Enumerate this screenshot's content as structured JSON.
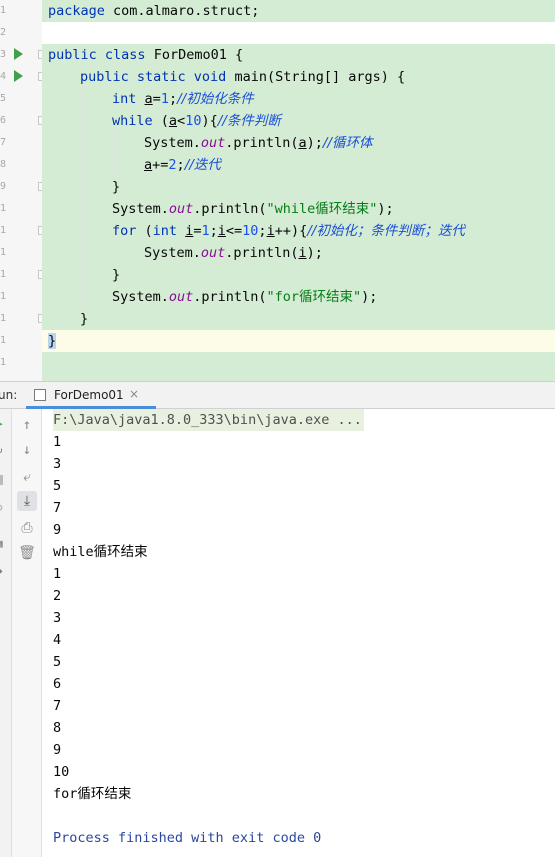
{
  "editor": {
    "lines": [
      {
        "num": "1"
      },
      {
        "num": "2"
      },
      {
        "num": "3"
      },
      {
        "num": "4"
      },
      {
        "num": "5"
      },
      {
        "num": "6"
      },
      {
        "num": "7"
      },
      {
        "num": "8"
      },
      {
        "num": "9"
      },
      {
        "num": "10"
      },
      {
        "num": "11"
      },
      {
        "num": "12"
      },
      {
        "num": "13"
      },
      {
        "num": "14"
      },
      {
        "num": "15"
      },
      {
        "num": "16"
      },
      {
        "num": "17"
      }
    ],
    "code": {
      "l1_pkg_kw": "package",
      "l1_pkg_name": " com.almaro.struct;",
      "l3_public": "public",
      "l3_class": "class",
      "l3_name": " ForDemo01 {",
      "l4_mods": "public static void",
      "l4_rest_a": " main(String[] args) {",
      "l5_int": "int",
      "l5_a": "a",
      "l5_eq": "=",
      "l5_num": "1",
      "l5_semi": ";",
      "l5_cmt": "//初始化条件",
      "l6_while": "while",
      "l6_open": " (",
      "l6_a": "a",
      "l6_lt": "<",
      "l6_num": "10",
      "l6_close": "){",
      "l6_cmt": "//条件判断",
      "l7_sys": "System.",
      "l7_out": "out",
      "l7_call": ".println(",
      "l7_a": "a",
      "l7_end": ");",
      "l7_cmt": "//循环体",
      "l8_a": "a",
      "l8_op": "+=",
      "l8_num": "2",
      "l8_semi": ";",
      "l8_cmt": "//迭代",
      "l9_brace": "}",
      "l10_sys": "System.",
      "l10_out": "out",
      "l10_call": ".println(",
      "l10_str": "\"while循环结束\"",
      "l10_end": ");",
      "l11_for": "for",
      "l11_open": " (",
      "l11_int": "int",
      "l11_sp": " ",
      "l11_i1": "i",
      "l11_eq": "=",
      "l11_n1": "1",
      "l11_s1": ";",
      "l11_i2": "i",
      "l11_le": "<=",
      "l11_n2": "10",
      "l11_s2": ";",
      "l11_i3": "i",
      "l11_inc": "++){",
      "l11_cmt": "//初始化；条件判断；迭代",
      "l12_sys": "System.",
      "l12_out": "out",
      "l12_call": ".println(",
      "l12_i": "i",
      "l12_end": ");",
      "l13_brace": "}",
      "l14_sys": "System.",
      "l14_out": "out",
      "l14_call": ".println(",
      "l14_str": "\"for循环结束\"",
      "l14_end": ");",
      "l15_brace": "}",
      "l16_brace": "}"
    }
  },
  "run_panel": {
    "label": "un:",
    "tab_title": "ForDemo01",
    "tab_close": "×"
  },
  "toolbar": {
    "up": "↑",
    "down": "↓",
    "wrap": "⤶",
    "scroll_end": "⤓",
    "print": "⎙",
    "trash": "🗑"
  },
  "console": {
    "command": "F:\\Java\\java1.8.0_333\\bin\\java.exe ...",
    "lines": [
      "1",
      "3",
      "5",
      "7",
      "9",
      "while循环结束",
      "1",
      "2",
      "3",
      "4",
      "5",
      "6",
      "7",
      "8",
      "9",
      "10",
      "for循环结束"
    ],
    "exit": "Process finished with exit code 0"
  },
  "colors": {
    "highlight": "#d4ebd4",
    "keyword": "#0033b3",
    "string": "#067d17",
    "number": "#1750eb",
    "comment": "#1a4fd6",
    "field": "#871094",
    "run_arrow": "#3fa14a"
  }
}
